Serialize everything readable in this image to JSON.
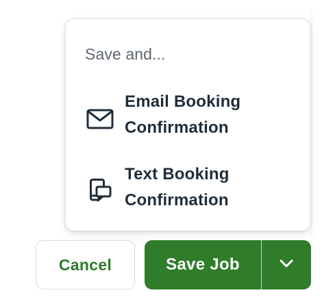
{
  "menu": {
    "heading": "Save and...",
    "items": [
      {
        "label_line1": "Email Booking",
        "label_line2": "Confirmation",
        "icon": "envelope-icon"
      },
      {
        "label_line1": "Text Booking",
        "label_line2": "Confirmation",
        "icon": "mobile-message-icon"
      }
    ]
  },
  "actions": {
    "cancel_label": "Cancel",
    "save_label": "Save Job",
    "caret_icon": "chevron-down-icon"
  },
  "colors": {
    "primary_green": "#2f7d2b",
    "cancel_text": "#2e7a2b",
    "menu_text": "#1f2d3a",
    "heading_text": "#5b6671"
  }
}
